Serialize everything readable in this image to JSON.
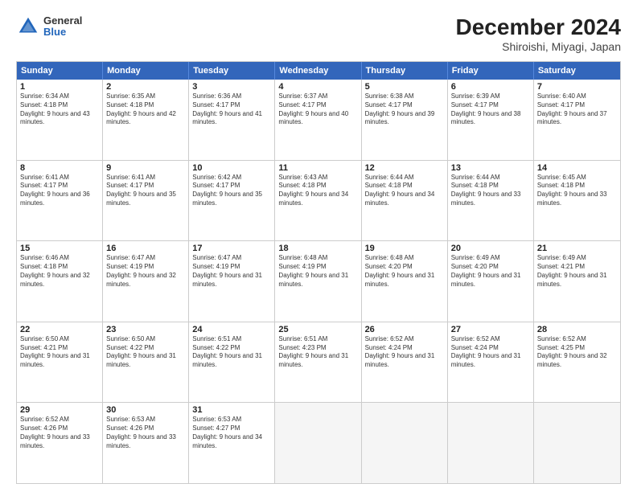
{
  "header": {
    "logo_general": "General",
    "logo_blue": "Blue",
    "title": "December 2024",
    "subtitle": "Shiroishi, Miyagi, Japan"
  },
  "days": [
    "Sunday",
    "Monday",
    "Tuesday",
    "Wednesday",
    "Thursday",
    "Friday",
    "Saturday"
  ],
  "rows": [
    [
      {
        "day": "1",
        "sunrise": "6:34 AM",
        "sunset": "4:18 PM",
        "daylight": "9 hours and 43 minutes."
      },
      {
        "day": "2",
        "sunrise": "6:35 AM",
        "sunset": "4:18 PM",
        "daylight": "9 hours and 42 minutes."
      },
      {
        "day": "3",
        "sunrise": "6:36 AM",
        "sunset": "4:17 PM",
        "daylight": "9 hours and 41 minutes."
      },
      {
        "day": "4",
        "sunrise": "6:37 AM",
        "sunset": "4:17 PM",
        "daylight": "9 hours and 40 minutes."
      },
      {
        "day": "5",
        "sunrise": "6:38 AM",
        "sunset": "4:17 PM",
        "daylight": "9 hours and 39 minutes."
      },
      {
        "day": "6",
        "sunrise": "6:39 AM",
        "sunset": "4:17 PM",
        "daylight": "9 hours and 38 minutes."
      },
      {
        "day": "7",
        "sunrise": "6:40 AM",
        "sunset": "4:17 PM",
        "daylight": "9 hours and 37 minutes."
      }
    ],
    [
      {
        "day": "8",
        "sunrise": "6:41 AM",
        "sunset": "4:17 PM",
        "daylight": "9 hours and 36 minutes."
      },
      {
        "day": "9",
        "sunrise": "6:41 AM",
        "sunset": "4:17 PM",
        "daylight": "9 hours and 35 minutes."
      },
      {
        "day": "10",
        "sunrise": "6:42 AM",
        "sunset": "4:17 PM",
        "daylight": "9 hours and 35 minutes."
      },
      {
        "day": "11",
        "sunrise": "6:43 AM",
        "sunset": "4:18 PM",
        "daylight": "9 hours and 34 minutes."
      },
      {
        "day": "12",
        "sunrise": "6:44 AM",
        "sunset": "4:18 PM",
        "daylight": "9 hours and 34 minutes."
      },
      {
        "day": "13",
        "sunrise": "6:44 AM",
        "sunset": "4:18 PM",
        "daylight": "9 hours and 33 minutes."
      },
      {
        "day": "14",
        "sunrise": "6:45 AM",
        "sunset": "4:18 PM",
        "daylight": "9 hours and 33 minutes."
      }
    ],
    [
      {
        "day": "15",
        "sunrise": "6:46 AM",
        "sunset": "4:18 PM",
        "daylight": "9 hours and 32 minutes."
      },
      {
        "day": "16",
        "sunrise": "6:47 AM",
        "sunset": "4:19 PM",
        "daylight": "9 hours and 32 minutes."
      },
      {
        "day": "17",
        "sunrise": "6:47 AM",
        "sunset": "4:19 PM",
        "daylight": "9 hours and 31 minutes."
      },
      {
        "day": "18",
        "sunrise": "6:48 AM",
        "sunset": "4:19 PM",
        "daylight": "9 hours and 31 minutes."
      },
      {
        "day": "19",
        "sunrise": "6:48 AM",
        "sunset": "4:20 PM",
        "daylight": "9 hours and 31 minutes."
      },
      {
        "day": "20",
        "sunrise": "6:49 AM",
        "sunset": "4:20 PM",
        "daylight": "9 hours and 31 minutes."
      },
      {
        "day": "21",
        "sunrise": "6:49 AM",
        "sunset": "4:21 PM",
        "daylight": "9 hours and 31 minutes."
      }
    ],
    [
      {
        "day": "22",
        "sunrise": "6:50 AM",
        "sunset": "4:21 PM",
        "daylight": "9 hours and 31 minutes."
      },
      {
        "day": "23",
        "sunrise": "6:50 AM",
        "sunset": "4:22 PM",
        "daylight": "9 hours and 31 minutes."
      },
      {
        "day": "24",
        "sunrise": "6:51 AM",
        "sunset": "4:22 PM",
        "daylight": "9 hours and 31 minutes."
      },
      {
        "day": "25",
        "sunrise": "6:51 AM",
        "sunset": "4:23 PM",
        "daylight": "9 hours and 31 minutes."
      },
      {
        "day": "26",
        "sunrise": "6:52 AM",
        "sunset": "4:24 PM",
        "daylight": "9 hours and 31 minutes."
      },
      {
        "day": "27",
        "sunrise": "6:52 AM",
        "sunset": "4:24 PM",
        "daylight": "9 hours and 31 minutes."
      },
      {
        "day": "28",
        "sunrise": "6:52 AM",
        "sunset": "4:25 PM",
        "daylight": "9 hours and 32 minutes."
      }
    ],
    [
      {
        "day": "29",
        "sunrise": "6:52 AM",
        "sunset": "4:26 PM",
        "daylight": "9 hours and 33 minutes."
      },
      {
        "day": "30",
        "sunrise": "6:53 AM",
        "sunset": "4:26 PM",
        "daylight": "9 hours and 33 minutes."
      },
      {
        "day": "31",
        "sunrise": "6:53 AM",
        "sunset": "4:27 PM",
        "daylight": "9 hours and 34 minutes."
      },
      null,
      null,
      null,
      null
    ]
  ]
}
